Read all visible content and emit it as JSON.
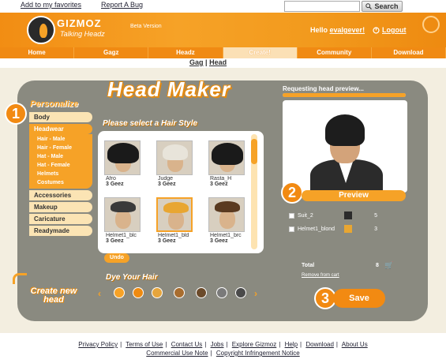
{
  "top": {
    "favorites": "Add to my favorites",
    "report": "Report A Bug",
    "search_placeholder": "",
    "search_button": "Search"
  },
  "header": {
    "logo": "GIZMOZ",
    "logo_sub": "Talking Headz",
    "beta": "Beta Version",
    "hello": "Hello",
    "username": "evalgever!",
    "logout": "Logout"
  },
  "nav": [
    "Home",
    "Gagz",
    "Headz",
    "Create!",
    "Community",
    "Download"
  ],
  "subnav": {
    "gag": "Gag",
    "sep": "|",
    "head": "Head"
  },
  "main": {
    "title": "Head Maker",
    "personalize": "Personalize",
    "step1": "1",
    "step2": "2",
    "step3": "3",
    "choose": "Please select a Hair Style",
    "undo": "Undo",
    "dye_title": "Dye Your Hair",
    "create_head": "Create new head"
  },
  "sidebar": {
    "top_items": [
      "Body",
      "Headwear"
    ],
    "sub_items": [
      "Hair - Male",
      "Hair - Female",
      "Hat - Male",
      "Hat - Female",
      "Helmets",
      "Costumes"
    ],
    "bottom_items": [
      "Accessories",
      "Makeup",
      "Caricature",
      "Readymade"
    ]
  },
  "hair_items": [
    {
      "name": "Afro",
      "price": "3 Geez"
    },
    {
      "name": "Judge",
      "price": "3 Geez"
    },
    {
      "name": "Rasta_H",
      "price": "3 Geez"
    },
    {
      "name": "Helmet1_blc",
      "price": "3 Geez"
    },
    {
      "name": "Helmet1_bld",
      "price": "3 Geez"
    },
    {
      "name": "Helmet1_brc",
      "price": "3 Geez"
    }
  ],
  "dye_colors": [
    "#f6a227",
    "#ee8a10",
    "#e6a53c",
    "#a86d2f",
    "#6b4a2a",
    "#7a7a7a",
    "#4a4a4a"
  ],
  "preview": {
    "requesting": "Requesting head preview...",
    "progress": 1,
    "button": "Preview"
  },
  "cart": {
    "items": [
      {
        "name": "Suit_2",
        "price": "5"
      },
      {
        "name": "Helmet1_blond",
        "price": "3"
      }
    ],
    "total_label": "Total",
    "total_value": "8",
    "remove": "Remove from cart",
    "save": "Save"
  },
  "footer": {
    "row1": [
      "Privacy Policy",
      "Terms of Use",
      "Contact Us",
      "Jobs",
      "Explore Gizmoz",
      "Help",
      "Download",
      "About Us"
    ],
    "row2": [
      "Commercial Use Note",
      "Copyright Infringement Notice"
    ]
  },
  "colors": {
    "accent": "#f6a227",
    "accent_dark": "#f08a13",
    "panel": "#8a8a80"
  }
}
